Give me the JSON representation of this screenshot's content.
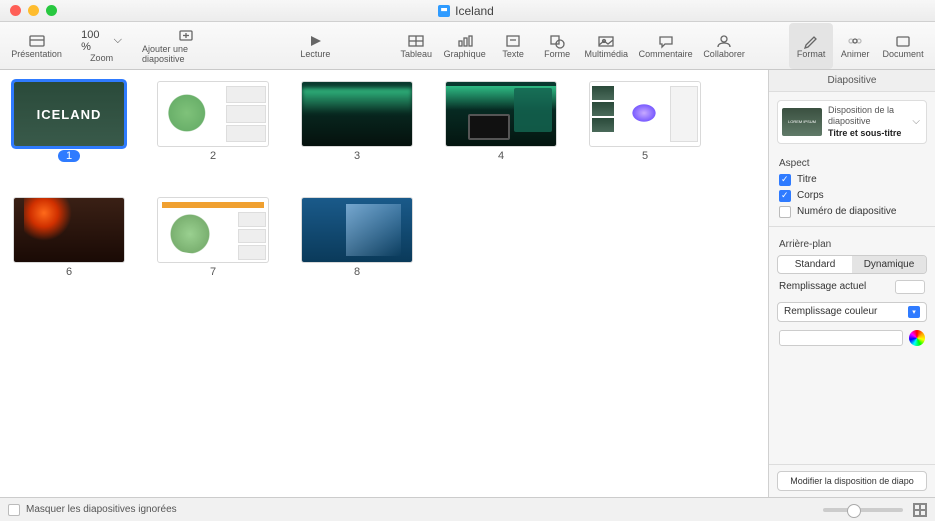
{
  "titlebar": {
    "title": "Iceland"
  },
  "toolbar": {
    "presentation": "Présentation",
    "zoom_value": "100 %",
    "zoom_label": "Zoom",
    "add_slide": "Ajouter une diapositive",
    "play": "Lecture",
    "table": "Tableau",
    "chart": "Graphique",
    "text": "Texte",
    "shape": "Forme",
    "media": "Multimédia",
    "comment": "Commentaire",
    "collaborate": "Collaborer",
    "format": "Format",
    "animate": "Animer",
    "document": "Document"
  },
  "slides": [
    {
      "num": "1",
      "title": "ICELAND"
    },
    {
      "num": "2"
    },
    {
      "num": "3"
    },
    {
      "num": "4"
    },
    {
      "num": "5"
    },
    {
      "num": "6"
    },
    {
      "num": "7"
    },
    {
      "num": "8"
    }
  ],
  "inspector": {
    "tab": "Diapositive",
    "layout_caption": "Disposition de la diapositive",
    "layout_name": "Titre et sous-titre",
    "layout_thumb_text": "LOREM IPSUM",
    "aspect_hdr": "Aspect",
    "chk_title": "Titre",
    "chk_body": "Corps",
    "chk_slide_num": "Numéro de diapositive",
    "background_hdr": "Arrière-plan",
    "seg_standard": "Standard",
    "seg_dynamic": "Dynamique",
    "current_fill": "Remplissage actuel",
    "fill_type": "Remplissage couleur",
    "modify_btn": "Modifier la disposition de diapo"
  },
  "footer": {
    "hide_skipped": "Masquer les diapositives ignorées"
  }
}
